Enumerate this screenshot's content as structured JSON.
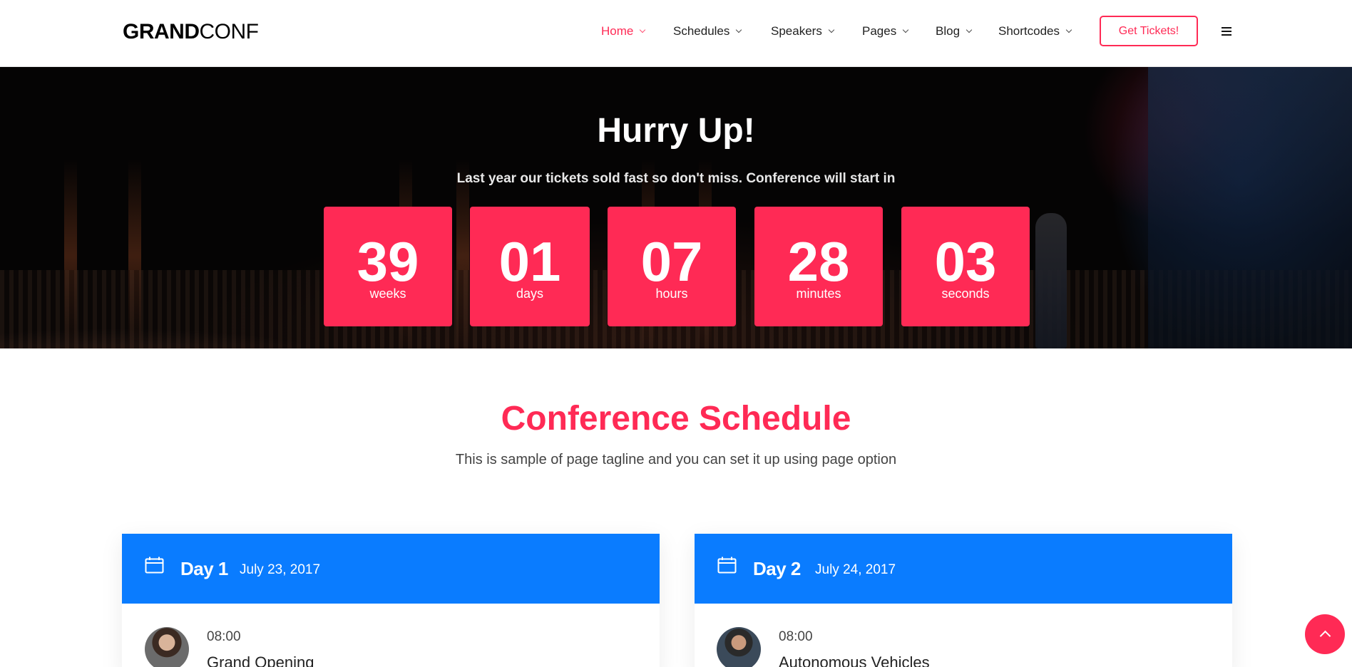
{
  "header": {
    "logo_bold": "GRAND",
    "logo_thin": "CONF",
    "nav": [
      {
        "label": "Home",
        "active": true
      },
      {
        "label": "Schedules",
        "active": false
      },
      {
        "label": "Speakers",
        "active": false
      },
      {
        "label": "Pages",
        "active": false
      },
      {
        "label": "Blog",
        "active": false
      },
      {
        "label": "Shortcodes",
        "active": false
      }
    ],
    "cta_label": "Get Tickets!",
    "menu_icon": "hamburger-icon"
  },
  "hero": {
    "title": "Hurry Up!",
    "subtitle": "Last year our tickets sold fast so don't miss. Conference will start in",
    "countdown": [
      {
        "value": "39",
        "unit": "weeks"
      },
      {
        "value": "01",
        "unit": "days"
      },
      {
        "value": "07",
        "unit": "hours"
      },
      {
        "value": "28",
        "unit": "minutes"
      },
      {
        "value": "03",
        "unit": "seconds"
      }
    ]
  },
  "schedule": {
    "title": "Conference Schedule",
    "tagline": "This is sample of page tagline and you can set it up using page option",
    "days": [
      {
        "name": "Day 1",
        "date": "July 23, 2017",
        "icon": "calendar-icon",
        "sessions": [
          {
            "time": "08:00",
            "title": "Grand Opening"
          }
        ]
      },
      {
        "name": "Day 2",
        "date": "July 24, 2017",
        "icon": "calendar-icon",
        "sessions": [
          {
            "time": "08:00",
            "title": "Autonomous Vehicles"
          }
        ]
      }
    ]
  },
  "scroll_top_icon": "chevron-up-icon",
  "colors": {
    "accent": "#ff2a55",
    "day_header": "#0a7cff"
  }
}
